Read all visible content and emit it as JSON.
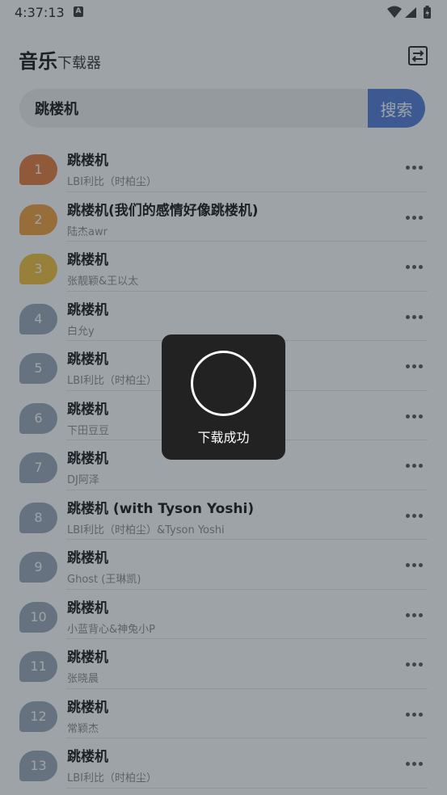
{
  "status_bar": {
    "time": "4:37:13",
    "notification_letter": "A"
  },
  "header": {
    "title_main": "音乐",
    "title_sub": "下载器"
  },
  "search": {
    "value": "跳楼机",
    "button_label": "搜索"
  },
  "songs": [
    {
      "rank": "1",
      "title": "跳楼机",
      "artist": "LBI利比（时柏尘）"
    },
    {
      "rank": "2",
      "title": "跳楼机(我们的感情好像跳楼机)",
      "artist": "陆杰awr"
    },
    {
      "rank": "3",
      "title": "跳楼机",
      "artist": "张靓颖&王以太"
    },
    {
      "rank": "4",
      "title": "跳楼机",
      "artist": "白允y"
    },
    {
      "rank": "5",
      "title": "跳楼机",
      "artist": "LBI利比（时柏尘）"
    },
    {
      "rank": "6",
      "title": "跳楼机",
      "artist": "下田豆豆"
    },
    {
      "rank": "7",
      "title": "跳楼机",
      "artist": "DJ阿泽"
    },
    {
      "rank": "8",
      "title": "跳楼机 (with Tyson Yoshi)",
      "artist": "LBI利比（时柏尘）&Tyson Yoshi"
    },
    {
      "rank": "9",
      "title": "跳楼机",
      "artist": "Ghost (王琳凯)"
    },
    {
      "rank": "10",
      "title": "跳楼机",
      "artist": "小蓝背心&神兔小P"
    },
    {
      "rank": "11",
      "title": "跳楼机",
      "artist": "张晓晨"
    },
    {
      "rank": "12",
      "title": "跳楼机",
      "artist": "常颖杰"
    },
    {
      "rank": "13",
      "title": "跳楼机",
      "artist": "LBI利比（时柏尘）"
    }
  ],
  "toast": {
    "message": "下载成功"
  },
  "colors": {
    "accent": "#4d79d8",
    "rank_1": "#e67a3a",
    "rank_2": "#f29e3a",
    "rank_3": "#f2c23a",
    "rank_other": "#9aa6b8"
  }
}
